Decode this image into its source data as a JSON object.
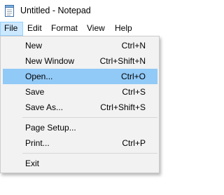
{
  "window": {
    "title": "Untitled - Notepad",
    "icon": "notepad-icon"
  },
  "menubar": {
    "items": [
      {
        "label": "File",
        "active": true
      },
      {
        "label": "Edit"
      },
      {
        "label": "Format"
      },
      {
        "label": "View"
      },
      {
        "label": "Help"
      }
    ]
  },
  "file_menu": {
    "items": [
      {
        "label": "New",
        "shortcut": "Ctrl+N"
      },
      {
        "label": "New Window",
        "shortcut": "Ctrl+Shift+N"
      },
      {
        "label": "Open...",
        "shortcut": "Ctrl+O",
        "highlighted": true
      },
      {
        "label": "Save",
        "shortcut": "Ctrl+S"
      },
      {
        "label": "Save As...",
        "shortcut": "Ctrl+Shift+S"
      },
      {
        "label": "Page Setup...",
        "shortcut": ""
      },
      {
        "label": "Print...",
        "shortcut": "Ctrl+P"
      },
      {
        "label": "Exit",
        "shortcut": ""
      }
    ]
  },
  "colors": {
    "menu_background": "#f2f2f2",
    "highlight": "#91c9f7",
    "active_menu": "#cce8ff"
  }
}
